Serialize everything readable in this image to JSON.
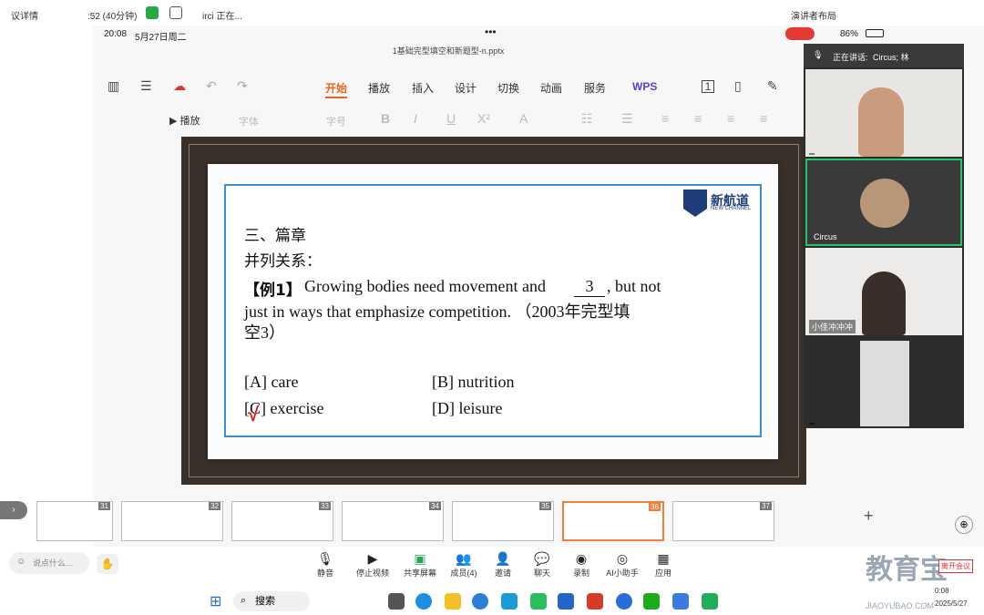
{
  "top_bar": {
    "meeting_info": "议详情",
    "timer": ":52 (40分钟)",
    "speaker_note": "irci 正在...",
    "presenter_layout": "演讲者布局"
  },
  "status_bar": {
    "time": "20:08",
    "date": "5月27日周二",
    "battery": "86%",
    "dots": "•••"
  },
  "file": {
    "name": "1基础完型填空和新题型-n.pptx"
  },
  "ribbon": {
    "tabs": [
      "开始",
      "播放",
      "插入",
      "设计",
      "切换",
      "动画",
      "服务"
    ],
    "active_tab": "开始",
    "wps_label": "WPS",
    "play_label": "播放",
    "font_placeholder": "字体",
    "size_placeholder": "字号"
  },
  "slide": {
    "logo_text": "新航道",
    "logo_sub": "NEW CHANNEL",
    "heading": "三、篇章",
    "subheading": "并列关系：",
    "example_label": "【例1】",
    "question_line1": "Growing bodies need movement and",
    "blank_number": "3",
    "question_line1_end": ", but not",
    "question_line2": "just in ways that emphasize competition. （2003年完型填",
    "question_line3": "空3）",
    "option_a": "[A] care",
    "option_b": "[B] nutrition",
    "option_c": "[C] exercise",
    "option_d": "[D] leisure",
    "check_mark": "√"
  },
  "participants": {
    "speaking_label": "正在讲话:",
    "speaking_name": "Circus; 林",
    "tiles": [
      {
        "name": ""
      },
      {
        "name": "Circus"
      },
      {
        "name": "小佳冲冲冲"
      },
      {
        "name": ""
      }
    ]
  },
  "thumbnails": [
    {
      "num": "31"
    },
    {
      "num": "32"
    },
    {
      "num": "33"
    },
    {
      "num": "34"
    },
    {
      "num": "35"
    },
    {
      "num": "36"
    },
    {
      "num": "37"
    }
  ],
  "meeting_toolbar": {
    "chat_placeholder": "说点什么...",
    "buttons": [
      {
        "label": "静音",
        "icon": "mic-icon"
      },
      {
        "label": "停止视频",
        "icon": "camera-icon"
      },
      {
        "label": "共享屏幕",
        "icon": "share-screen-icon"
      },
      {
        "label": "成员(4)",
        "icon": "members-icon"
      },
      {
        "label": "邀请",
        "icon": "invite-icon"
      },
      {
        "label": "聊天",
        "icon": "chat-icon"
      },
      {
        "label": "录制",
        "icon": "record-icon"
      },
      {
        "label": "AI小助手",
        "icon": "ai-assistant-icon"
      },
      {
        "label": "应用",
        "icon": "apps-icon"
      }
    ]
  },
  "watermark": {
    "main": "教育宝",
    "sub": "JIAOYUBAO.COM",
    "tag": "离开会议"
  },
  "taskbar": {
    "search_label": "搜索",
    "clock_time": "0:08",
    "clock_date": "2025/5/27"
  },
  "colors": {
    "accent_orange": "#e9681f",
    "record_red": "#e53935",
    "slide_border": "#3a8fd1",
    "active_thumb": "#f07e3c"
  }
}
